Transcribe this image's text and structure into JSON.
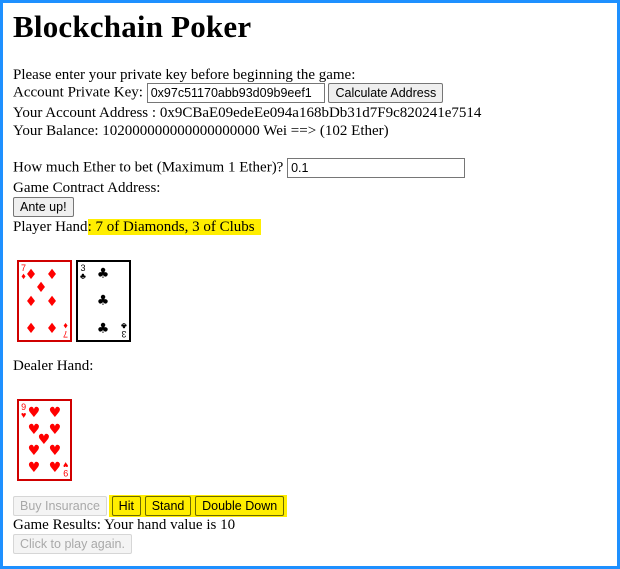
{
  "title": "Blockchain Poker",
  "intro": "Please enter your private key before beginning the game:",
  "private_key": {
    "label": "Account Private Key:",
    "value": "0x97c51170abb93d09b9eef1",
    "button": "Calculate Address"
  },
  "account_address": "Your Account Address : 0x9CBaE09edeEe094a168bDb31d7F9c820241e7514",
  "balance": "Your Balance: 102000000000000000000 Wei ==> (102 Ether)",
  "bet": {
    "label": "How much Ether to bet (Maximum 1 Ether)?",
    "value": "0.1"
  },
  "contract_label": "Game Contract Address:",
  "ante_button": "Ante up!",
  "player_hand": {
    "label": "Player Hand",
    "value": ": 7 of Diamonds, 3 of Clubs",
    "cards": [
      {
        "rank": "7",
        "suit": "♦",
        "color": "#ff0000"
      },
      {
        "rank": "3",
        "suit": "♣",
        "color": "#000000"
      }
    ]
  },
  "dealer_hand": {
    "label": "Dealer Hand:",
    "cards": [
      {
        "rank": "9",
        "suit": "♥",
        "color": "#ff0000"
      }
    ]
  },
  "actions": {
    "insurance": "Buy Insurance",
    "hit": "Hit",
    "stand": "Stand",
    "double_down": "Double Down"
  },
  "results": "Game Results: Your hand value is 10",
  "play_again": "Click to play again.",
  "colors": {
    "frame": "#1e90ff",
    "highlight": "#ffee00",
    "red_suit": "#ff0000"
  }
}
